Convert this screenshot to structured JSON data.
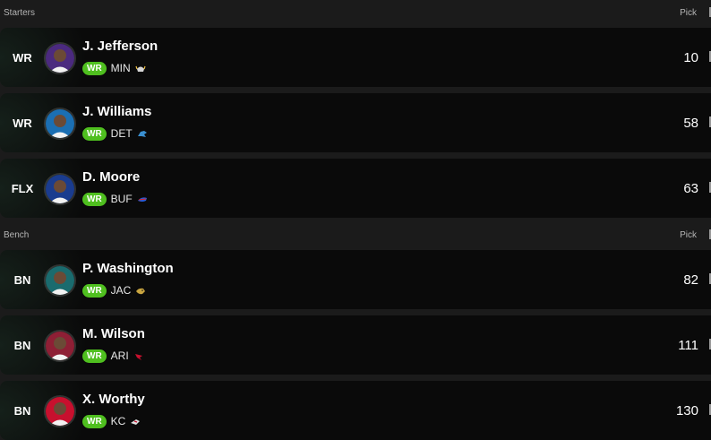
{
  "sections": [
    {
      "label": "Starters",
      "pick_header": "Pick",
      "rows": [
        {
          "slot": "WR",
          "name": "J. Jefferson",
          "position": "WR",
          "team": "MIN",
          "team_icon": "vikings-icon",
          "avatar_color": "#4b2a7f",
          "pick": "10"
        },
        {
          "slot": "WR",
          "name": "J. Williams",
          "position": "WR",
          "team": "DET",
          "team_icon": "lions-icon",
          "avatar_color": "#1b6fb3",
          "pick": "58"
        },
        {
          "slot": "FLX",
          "name": "D. Moore",
          "position": "WR",
          "team": "BUF",
          "team_icon": "bills-icon",
          "avatar_color": "#1a3c8f",
          "pick": "63"
        }
      ]
    },
    {
      "label": "Bench",
      "pick_header": "Pick",
      "rows": [
        {
          "slot": "BN",
          "name": "P. Washington",
          "position": "WR",
          "team": "JAC",
          "team_icon": "jaguars-icon",
          "avatar_color": "#1a6b6e",
          "pick": "82"
        },
        {
          "slot": "BN",
          "name": "M. Wilson",
          "position": "WR",
          "team": "ARI",
          "team_icon": "cardinals-icon",
          "avatar_color": "#8e1f35",
          "pick": "111"
        },
        {
          "slot": "BN",
          "name": "X. Worthy",
          "position": "WR",
          "team": "KC",
          "team_icon": "chiefs-icon",
          "avatar_color": "#c8102e",
          "pick": "130"
        }
      ]
    }
  ],
  "colors": {
    "position_badge": "#4fbf1f",
    "background": "#1b1b1b",
    "row": "#0a0a0a"
  }
}
